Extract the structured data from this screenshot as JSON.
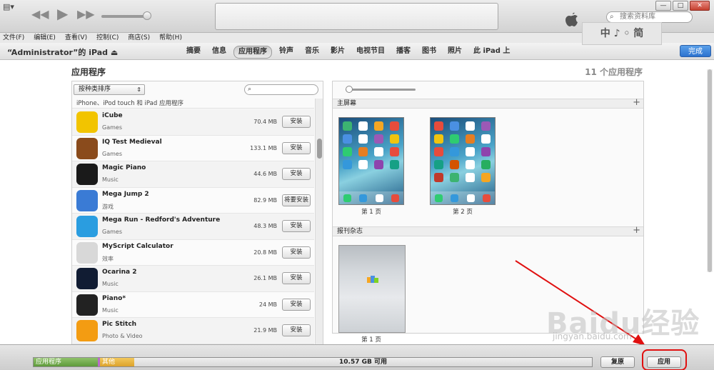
{
  "window": {
    "search_placeholder": "搜索资料库",
    "controls": {
      "minimize": "—",
      "maximize": "□",
      "close": "✕"
    }
  },
  "menu": [
    "文件(F)",
    "编辑(E)",
    "查看(V)",
    "控制(C)",
    "商店(S)",
    "帮助(H)"
  ],
  "device": {
    "name": "“Administrator”的 iPad ⏏",
    "tabs": [
      "摘要",
      "信息",
      "应用程序",
      "铃声",
      "音乐",
      "影片",
      "电视节目",
      "播客",
      "图书",
      "照片",
      "此 iPad 上"
    ],
    "active_tab": "应用程序",
    "done_label": "完成",
    "logo_text": "中 ♪ ◦ 简"
  },
  "apps_page": {
    "title": "应用程序",
    "count_label": "11 个应用程序",
    "sort_label": "按种类排序",
    "section_label": "iPhone、iPod touch 和 iPad 应用程序",
    "apps": [
      {
        "name": "iCube",
        "category": "Games",
        "size": "70.4 MB",
        "action": "安装",
        "color": "#f2c400"
      },
      {
        "name": "IQ Test Medieval",
        "category": "Games",
        "size": "133.1 MB",
        "action": "安装",
        "color": "#8a4b1c"
      },
      {
        "name": "Magic Piano",
        "category": "Music",
        "size": "44.6 MB",
        "action": "安装",
        "color": "#1a1a1a"
      },
      {
        "name": "Mega Jump 2",
        "category": "游戏",
        "size": "82.9 MB",
        "action": "将要安装",
        "color": "#3a7bd5"
      },
      {
        "name": "Mega Run - Redford's Adventure",
        "category": "Games",
        "size": "48.3 MB",
        "action": "安装",
        "color": "#2a9de0"
      },
      {
        "name": "MyScript Calculator",
        "category": "效率",
        "size": "20.8 MB",
        "action": "安装",
        "color": "#d8d8d8"
      },
      {
        "name": "Ocarina 2",
        "category": "Music",
        "size": "26.1 MB",
        "action": "安装",
        "color": "#111c33"
      },
      {
        "name": "Piano*",
        "category": "Music",
        "size": "24 MB",
        "action": "安装",
        "color": "#222222"
      },
      {
        "name": "Pic Stitch",
        "category": "Photo & Video",
        "size": "21.9 MB",
        "action": "安装",
        "color": "#f39c12"
      }
    ]
  },
  "home_screens": {
    "section_label": "主屏幕",
    "pages": [
      "第 1 页",
      "第 2 页"
    ],
    "newsstand_label": "报刊杂志",
    "newsstand_page": "第 1 页"
  },
  "storage": {
    "apps_label": "应用程序",
    "other_label": "其他",
    "free_label": "10.57 GB 可用"
  },
  "footer": {
    "restore_label": "复原",
    "apply_label": "应用"
  },
  "watermark": {
    "brand": "Baidu经验",
    "url": "jingyan.baidu.com"
  }
}
